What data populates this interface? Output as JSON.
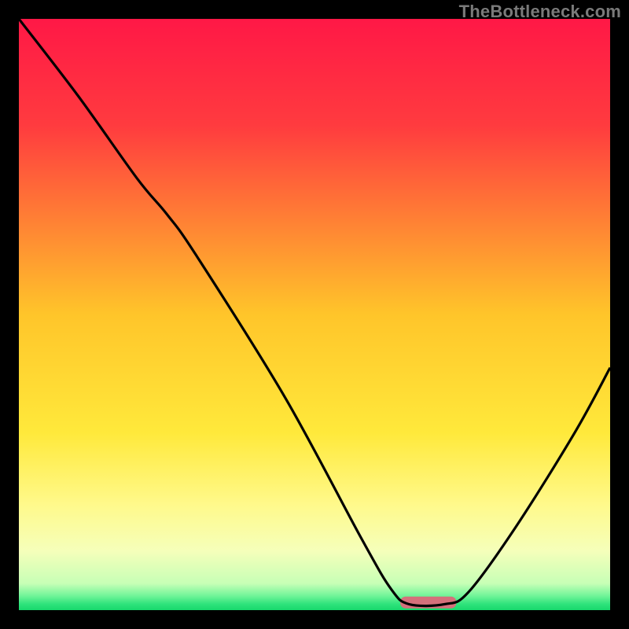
{
  "watermark": "TheBottleneck.com",
  "chart_data": {
    "type": "line",
    "title": "",
    "xlabel": "",
    "ylabel": "",
    "xlim": [
      0,
      100
    ],
    "ylim": [
      0,
      100
    ],
    "background": {
      "type": "vertical_gradient",
      "stops": [
        {
          "pos": 0.0,
          "color": "#ff1846"
        },
        {
          "pos": 0.18,
          "color": "#ff3b3f"
        },
        {
          "pos": 0.5,
          "color": "#ffc52a"
        },
        {
          "pos": 0.7,
          "color": "#ffe93b"
        },
        {
          "pos": 0.82,
          "color": "#fff98a"
        },
        {
          "pos": 0.9,
          "color": "#f5ffba"
        },
        {
          "pos": 0.955,
          "color": "#c7ffb6"
        },
        {
          "pos": 0.975,
          "color": "#74f59a"
        },
        {
          "pos": 0.99,
          "color": "#2ee37b"
        },
        {
          "pos": 1.0,
          "color": "#17d86c"
        }
      ]
    },
    "series": [
      {
        "name": "bottleneck-curve",
        "color": "#000000",
        "points": [
          {
            "x": 0.0,
            "y": 100.0
          },
          {
            "x": 10.0,
            "y": 87.0
          },
          {
            "x": 20.0,
            "y": 73.0
          },
          {
            "x": 25.0,
            "y": 67.0
          },
          {
            "x": 30.0,
            "y": 60.0
          },
          {
            "x": 45.0,
            "y": 36.0
          },
          {
            "x": 58.0,
            "y": 12.0
          },
          {
            "x": 63.0,
            "y": 3.5
          },
          {
            "x": 66.0,
            "y": 1.0
          },
          {
            "x": 72.0,
            "y": 1.0
          },
          {
            "x": 76.0,
            "y": 3.0
          },
          {
            "x": 84.0,
            "y": 14.0
          },
          {
            "x": 94.0,
            "y": 30.0
          },
          {
            "x": 100.0,
            "y": 41.0
          }
        ]
      }
    ],
    "marker": {
      "name": "optimal-zone",
      "shape": "rounded-bar",
      "color": "#d4707b",
      "x_start": 64.5,
      "x_end": 74.0,
      "y": 0.3,
      "height": 2.0
    }
  }
}
